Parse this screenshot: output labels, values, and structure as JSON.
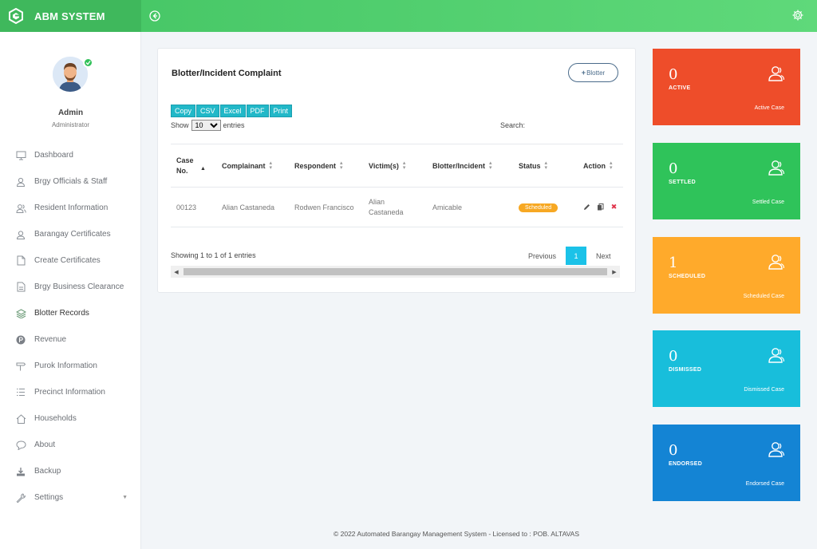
{
  "brand": {
    "name": "ABM SYSTEM"
  },
  "user": {
    "name": "Admin",
    "role": "Administrator"
  },
  "sidebar": {
    "items": [
      {
        "label": "Dashboard",
        "icon": "monitor-icon"
      },
      {
        "label": "Brgy Officials & Staff",
        "icon": "user-icon"
      },
      {
        "label": "Resident Information",
        "icon": "users-icon"
      },
      {
        "label": "Barangay Certificates",
        "icon": "badge-icon"
      },
      {
        "label": "Create Certificates",
        "icon": "document-icon"
      },
      {
        "label": "Brgy Business Clearance",
        "icon": "file-icon"
      },
      {
        "label": "Blotter Records",
        "icon": "layers-icon"
      },
      {
        "label": "Revenue",
        "icon": "peso-icon"
      },
      {
        "label": "Purok Information",
        "icon": "signpost-icon"
      },
      {
        "label": "Precinct Information",
        "icon": "list-icon"
      },
      {
        "label": "Households",
        "icon": "home-icon"
      },
      {
        "label": "About",
        "icon": "chat-icon"
      },
      {
        "label": "Backup",
        "icon": "download-icon"
      },
      {
        "label": "Settings",
        "icon": "wrench-icon"
      }
    ]
  },
  "panel": {
    "title": "Blotter/Incident Complaint",
    "add_button": "Blotter",
    "export_buttons": [
      "Copy",
      "CSV",
      "Excel",
      "PDF",
      "Print"
    ],
    "show_label": "Show",
    "entries_value": "10",
    "entries_label": "entries",
    "search_label": "Search:"
  },
  "table": {
    "headers": [
      "Case No.",
      "Complainant",
      "Respondent",
      "Victim(s)",
      "Blotter/Incident",
      "Status",
      "Action"
    ],
    "rows": [
      {
        "case_no": "00123",
        "complainant": "Alian Castaneda",
        "respondent": "Rodwen Francisco",
        "victims": "Alian Castaneda",
        "incident": "Amicable",
        "status": "Scheduled"
      }
    ]
  },
  "pagination": {
    "info": "Showing 1 to 1 of 1 entries",
    "previous": "Previous",
    "current": "1",
    "next": "Next"
  },
  "cards": [
    {
      "value": "0",
      "label": "ACTIVE",
      "sub": "Active Case",
      "color": "#ee4d2a"
    },
    {
      "value": "0",
      "label": "SETTLED",
      "sub": "Settled Case",
      "color": "#2fc35a"
    },
    {
      "value": "1",
      "label": "SCHEDULED",
      "sub": "Scheduled Case",
      "color": "#ffaa2b"
    },
    {
      "value": "0",
      "label": "DISMISSED",
      "sub": "Dismissed Case",
      "color": "#18bedb"
    },
    {
      "value": "0",
      "label": "ENDORSED",
      "sub": "Endorsed Case",
      "color": "#1484d4"
    }
  ],
  "footer": "© 2022 Automated Barangay Management System - Licensed to : POB. ALTAVAS"
}
